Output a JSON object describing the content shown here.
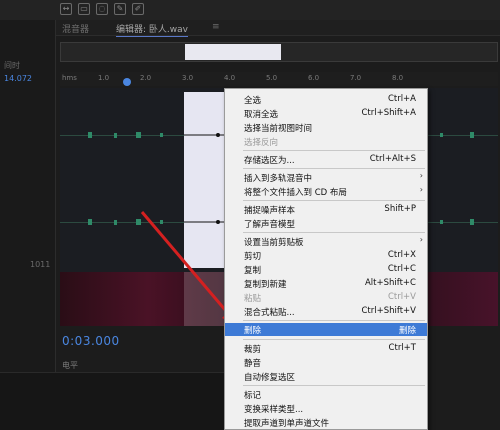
{
  "tabs": {
    "mixer": "混音器",
    "editor": "编辑器: 卧人.wav",
    "menu_glyph": "≡"
  },
  "left_panel": {
    "time_label": "间时",
    "timecode": "14.072",
    "value_label": "1011"
  },
  "ruler": {
    "unit": "hms",
    "ticks": [
      "1.0",
      "2.0",
      "3.0",
      "4.0",
      "5.0",
      "6.0",
      "7.0",
      "8.0"
    ]
  },
  "time_display": "0:03.000",
  "bottom": {
    "label": "电平"
  },
  "menu": {
    "items": [
      {
        "label": "全选",
        "shortcut": "Ctrl+A"
      },
      {
        "label": "取消全选",
        "shortcut": "Ctrl+Shift+A"
      },
      {
        "label": "选择当前视图时间",
        "shortcut": ""
      },
      {
        "label": "选择反向",
        "shortcut": "",
        "disabled": true
      },
      {
        "separator": true
      },
      {
        "label": "存储选区为...",
        "shortcut": "Ctrl+Alt+S"
      },
      {
        "separator": true
      },
      {
        "label": "插入到多轨混音中",
        "shortcut": "",
        "submenu": true
      },
      {
        "label": "将整个文件插入到 CD 布局",
        "shortcut": "",
        "submenu": true
      },
      {
        "separator": true
      },
      {
        "label": "捕捉噪声样本",
        "shortcut": "Shift+P"
      },
      {
        "label": "了解声音模型",
        "shortcut": ""
      },
      {
        "separator": true
      },
      {
        "label": "设置当前剪贴板",
        "shortcut": "",
        "submenu": true
      },
      {
        "label": "剪切",
        "shortcut": "Ctrl+X"
      },
      {
        "label": "复制",
        "shortcut": "Ctrl+C"
      },
      {
        "label": "复制到新建",
        "shortcut": "Alt+Shift+C"
      },
      {
        "label": "粘贴",
        "shortcut": "Ctrl+V",
        "disabled": true
      },
      {
        "label": "混合式粘贴...",
        "shortcut": "Ctrl+Shift+V"
      },
      {
        "separator": true
      },
      {
        "label": "删除",
        "shortcut": "删除",
        "highlighted": true
      },
      {
        "separator": true
      },
      {
        "label": "裁剪",
        "shortcut": "Ctrl+T"
      },
      {
        "label": "静音",
        "shortcut": ""
      },
      {
        "label": "自动修复选区",
        "shortcut": ""
      },
      {
        "separator": true
      },
      {
        "label": "标记",
        "shortcut": ""
      },
      {
        "label": "变换采样类型...",
        "shortcut": ""
      },
      {
        "label": "提取声道到单声道文件",
        "shortcut": ""
      }
    ]
  },
  "colors": {
    "menu_highlight": "#3d7ad6",
    "accent_blue": "#4a86e0",
    "arrow_red": "#d42020",
    "waveform_green": "#2f8a68"
  },
  "icons": {
    "arrow_annotation": "red-arrow-pointing-to-delete"
  }
}
